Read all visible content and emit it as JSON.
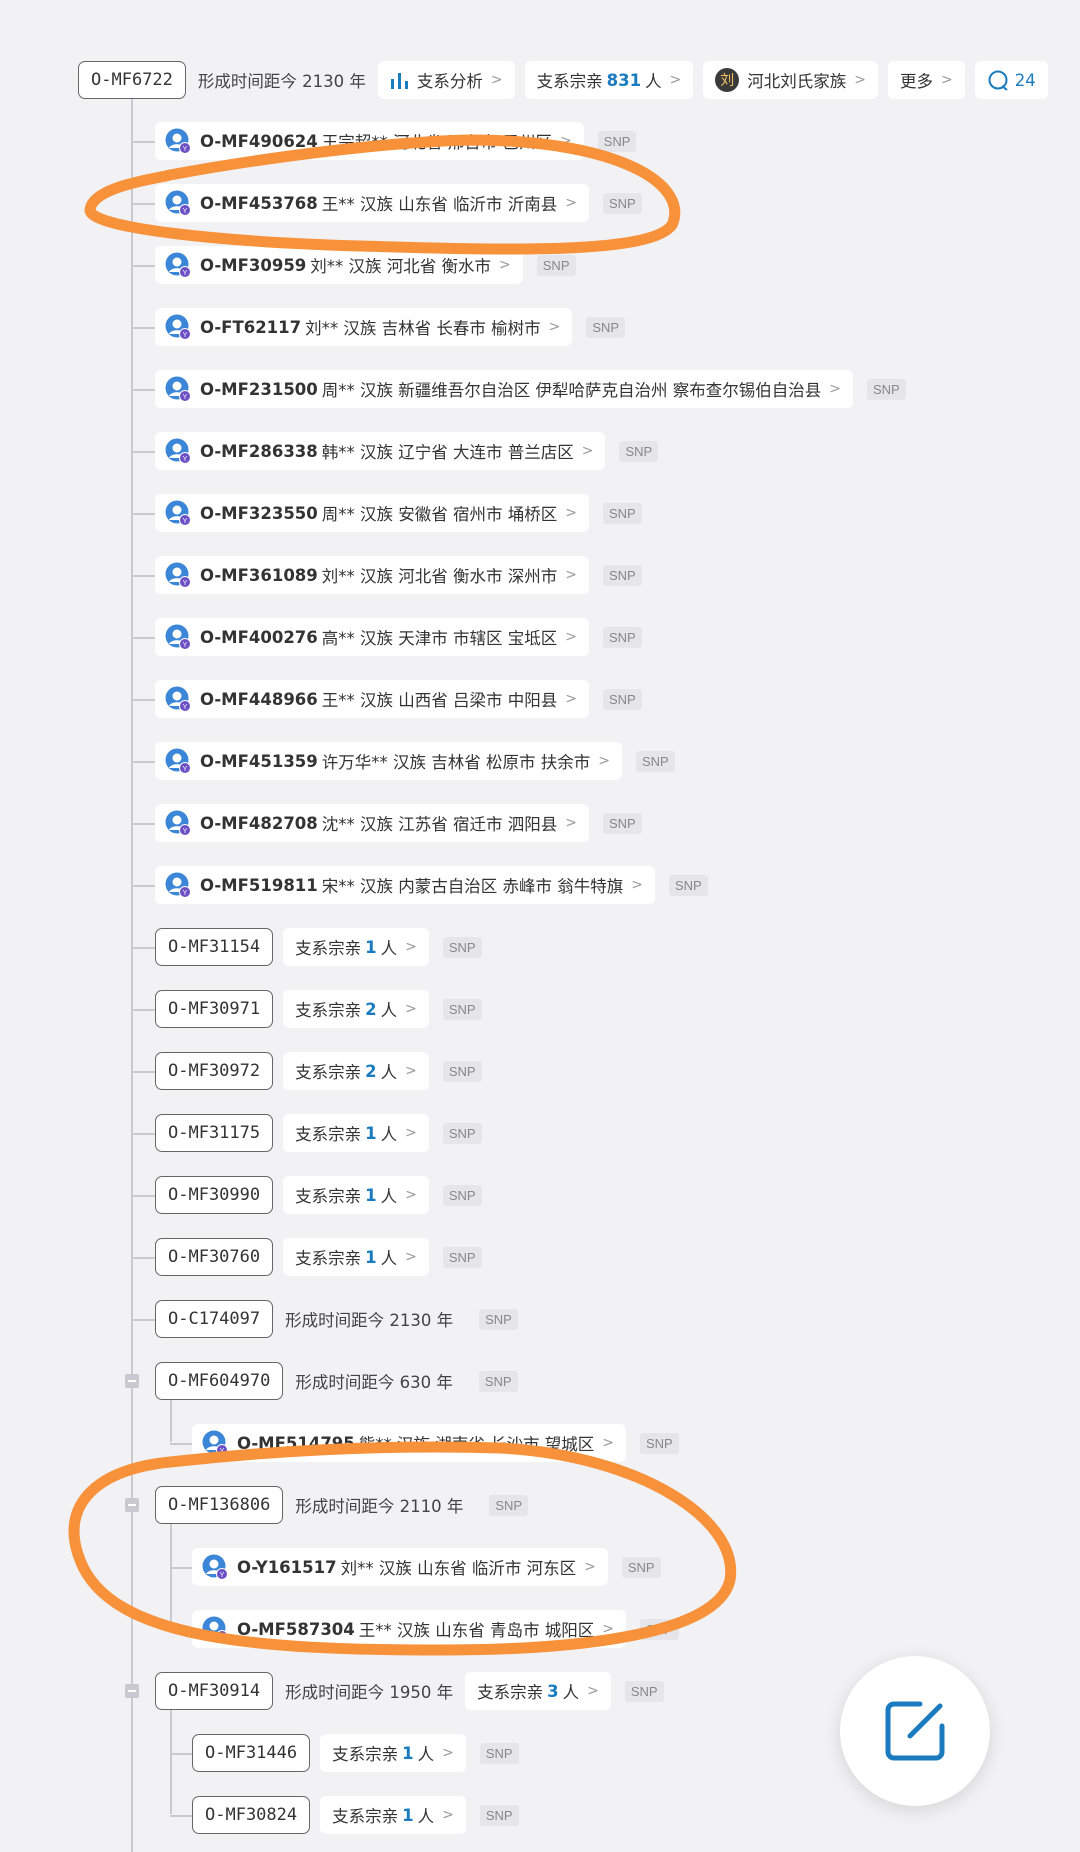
{
  "root": {
    "id": "O-MF6722",
    "time": "形成时间距今 2130 年",
    "analysis_label": "支系分析",
    "relatives_prefix": "支系宗亲",
    "relatives_count": "831",
    "relatives_suffix": "人",
    "clan_char": "刘",
    "clan_label": "河北刘氏家族",
    "more_label": "更多",
    "comment_count": "24"
  },
  "persons_l1": [
    {
      "id": "O-MF490624",
      "info": "王宗超** 河北省 邢台市 巴州区",
      "snp": "SNP"
    },
    {
      "id": "O-MF453768",
      "info": "王** 汉族 山东省 临沂市 沂南县",
      "snp": "SNP"
    },
    {
      "id": "O-MF30959",
      "info": "刘** 汉族 河北省 衡水市",
      "snp": "SNP"
    },
    {
      "id": "O-FT62117",
      "info": "刘** 汉族 吉林省 长春市 榆树市",
      "snp": "SNP"
    },
    {
      "id": "O-MF231500",
      "info": "周** 汉族 新疆维吾尔自治区 伊犁哈萨克自治州 察布查尔锡伯自治县",
      "snp": "SNP"
    },
    {
      "id": "O-MF286338",
      "info": "韩** 汉族 辽宁省 大连市 普兰店区",
      "snp": "SNP"
    },
    {
      "id": "O-MF323550",
      "info": "周** 汉族 安徽省 宿州市 埇桥区",
      "snp": "SNP"
    },
    {
      "id": "O-MF361089",
      "info": "刘** 汉族 河北省 衡水市 深州市",
      "snp": "SNP"
    },
    {
      "id": "O-MF400276",
      "info": "高** 汉族 天津市 市辖区 宝坻区",
      "snp": "SNP"
    },
    {
      "id": "O-MF448966",
      "info": "王** 汉族 山西省 吕梁市 中阳县",
      "snp": "SNP"
    },
    {
      "id": "O-MF451359",
      "info": "许万华** 汉族 吉林省 松原市 扶余市",
      "snp": "SNP"
    },
    {
      "id": "O-MF482708",
      "info": "沈** 汉族 江苏省 宿迁市 泗阳县",
      "snp": "SNP"
    },
    {
      "id": "O-MF519811",
      "info": "宋** 汉族 内蒙古自治区 赤峰市 翁牛特旗",
      "snp": "SNP"
    }
  ],
  "subclades_l1": [
    {
      "id": "O-MF31154",
      "prefix": "支系宗亲",
      "count": "1",
      "suffix": "人",
      "snp": "SNP"
    },
    {
      "id": "O-MF30971",
      "prefix": "支系宗亲",
      "count": "2",
      "suffix": "人",
      "snp": "SNP"
    },
    {
      "id": "O-MF30972",
      "prefix": "支系宗亲",
      "count": "2",
      "suffix": "人",
      "snp": "SNP"
    },
    {
      "id": "O-MF31175",
      "prefix": "支系宗亲",
      "count": "1",
      "suffix": "人",
      "snp": "SNP"
    },
    {
      "id": "O-MF30990",
      "prefix": "支系宗亲",
      "count": "1",
      "suffix": "人",
      "snp": "SNP"
    },
    {
      "id": "O-MF30760",
      "prefix": "支系宗亲",
      "count": "1",
      "suffix": "人",
      "snp": "SNP"
    }
  ],
  "c174097": {
    "id": "O-C174097",
    "time": "形成时间距今 2130 年",
    "snp": "SNP"
  },
  "mf604970": {
    "id": "O-MF604970",
    "time": "形成时间距今 630 年",
    "snp": "SNP",
    "children": [
      {
        "id": "O-MF514795",
        "info": "熊** 汉族 湖南省 长沙市 望城区",
        "snp": "SNP"
      }
    ]
  },
  "mf136806": {
    "id": "O-MF136806",
    "time": "形成时间距今 2110 年",
    "snp": "SNP",
    "children": [
      {
        "id": "O-Y161517",
        "info": "刘** 汉族 山东省 临沂市 河东区",
        "snp": "SNP"
      },
      {
        "id": "O-MF587304",
        "info": "王** 汉族 山东省 青岛市 城阳区",
        "snp": "SNP"
      }
    ]
  },
  "mf30914": {
    "id": "O-MF30914",
    "time": "形成时间距今 1950 年",
    "prefix": "支系宗亲",
    "count": "3",
    "suffix": "人",
    "snp": "SNP",
    "children": [
      {
        "id": "O-MF31446",
        "prefix": "支系宗亲",
        "count": "1",
        "suffix": "人",
        "snp": "SNP"
      },
      {
        "id": "O-MF30824",
        "prefix": "支系宗亲",
        "count": "1",
        "suffix": "人",
        "snp": "SNP"
      }
    ]
  },
  "colors": {
    "annotation": "#f7913a",
    "accent": "#1a7bbf",
    "avatar": "#3b86d6",
    "badge": "#6b4fc4"
  },
  "icons": {
    "edit": "edit-icon",
    "analysis": "bar-chart-icon",
    "comment": "comment-icon"
  }
}
